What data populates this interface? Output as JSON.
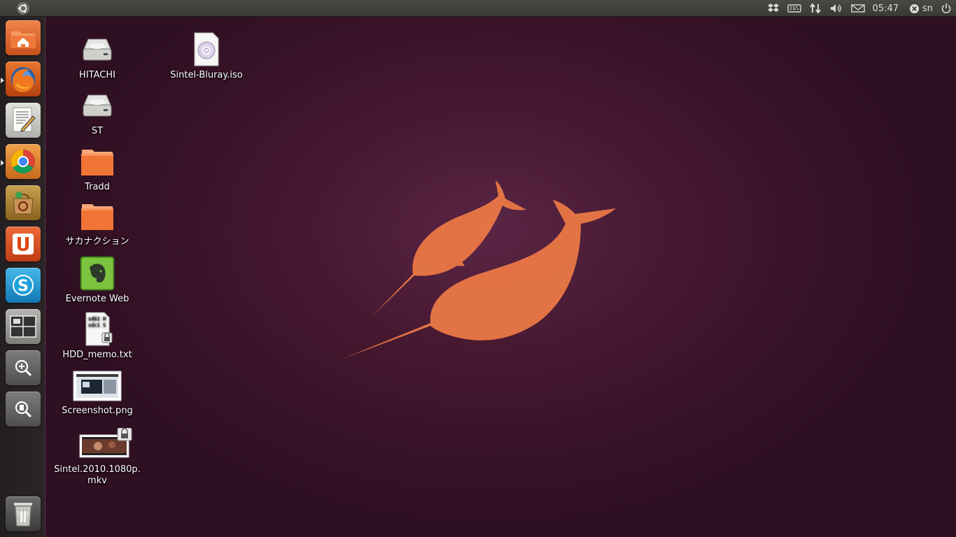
{
  "panel": {
    "clock": "05:47",
    "user": "sn",
    "icons": [
      "ubuntu-logo-icon",
      "dropbox-icon",
      "keyboard-icon",
      "network-icon",
      "volume-icon",
      "mail-icon",
      "chat-status-icon",
      "power-icon"
    ]
  },
  "launcher": {
    "items": [
      {
        "name": "home-folder",
        "icon": "home-icon",
        "color": "#e06a2a"
      },
      {
        "name": "firefox",
        "icon": "firefox-icon",
        "color": "#d95a1d",
        "running": true
      },
      {
        "name": "text-editor",
        "icon": "text-editor-icon",
        "color": "#d7d7d4"
      },
      {
        "name": "chrome",
        "icon": "chrome-icon",
        "color": "#e08636",
        "running": true
      },
      {
        "name": "software-center",
        "icon": "software-center-icon",
        "color": "#b48b3a"
      },
      {
        "name": "ubuntu-one",
        "icon": "ubuntu-one-icon",
        "color": "#d94e20"
      },
      {
        "name": "skype",
        "icon": "skype-icon",
        "color": "#1fa0d8"
      },
      {
        "name": "workspace-switcher",
        "icon": "workspace-icon",
        "color": "#9a9a98"
      },
      {
        "name": "apps-lens",
        "icon": "zoom-apps-icon",
        "color": "#6b6b69"
      },
      {
        "name": "files-lens",
        "icon": "zoom-files-icon",
        "color": "#6b6b69"
      },
      {
        "name": "trash",
        "icon": "trash-icon",
        "color": "#5a5a58"
      }
    ]
  },
  "desktop": {
    "icons": [
      {
        "label": "HITACHI",
        "icon": "drive-icon"
      },
      {
        "label": "ST",
        "icon": "drive-icon"
      },
      {
        "label": "Tradd",
        "icon": "folder-icon"
      },
      {
        "label": "サカナクション",
        "icon": "folder-icon"
      },
      {
        "label": "Evernote Web",
        "icon": "evernote-icon"
      },
      {
        "label": "HDD_memo.txt",
        "icon": "text-file-icon",
        "preview": [
          "sdb1 H",
          "sdc1 S"
        ]
      },
      {
        "label": "Screenshot.png",
        "icon": "image-file-icon"
      },
      {
        "label": "Sintel.2010.1080p.",
        "label2": "mkv",
        "icon": "video-file-icon"
      },
      {
        "label": "Sintel-Bluray.iso",
        "icon": "disc-image-icon"
      }
    ]
  },
  "colors": {
    "wallpaper": "#45182f",
    "narwhal": "#f07a45",
    "folder": "#f07436"
  }
}
